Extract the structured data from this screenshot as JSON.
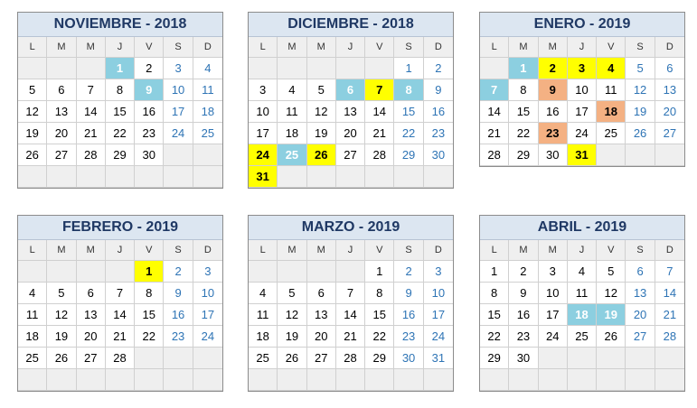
{
  "weekday_labels": [
    "L",
    "M",
    "M",
    "J",
    "V",
    "S",
    "D"
  ],
  "months": [
    {
      "title": "NOVIEMBRE - 2018",
      "offset": 3,
      "days": 30,
      "rows": 6,
      "marks": {
        "1": "festivo",
        "9": "festivo"
      }
    },
    {
      "title": "DICIEMBRE - 2018",
      "offset": 5,
      "days": 31,
      "rows": 6,
      "marks": {
        "6": "festivo",
        "7": "amarillo",
        "8": "festivo",
        "24": "amarillo",
        "25": "festivo",
        "26": "amarillo",
        "31": "amarillo"
      }
    },
    {
      "title": "ENERO - 2019",
      "offset": 1,
      "days": 31,
      "rows": 5,
      "marks": {
        "1": "festivo",
        "2": "amarillo",
        "3": "amarillo",
        "4": "amarillo",
        "7": "festivo",
        "9": "naranja",
        "18": "naranja",
        "23": "naranja",
        "31": "amarillo"
      }
    },
    {
      "title": "FEBRERO - 2019",
      "offset": 4,
      "days": 28,
      "rows": 6,
      "marks": {
        "1": "amarillo"
      }
    },
    {
      "title": "MARZO - 2019",
      "offset": 4,
      "days": 31,
      "rows": 6,
      "marks": {}
    },
    {
      "title": "ABRIL - 2019",
      "offset": 0,
      "days": 30,
      "rows": 6,
      "marks": {
        "18": "festivo",
        "19": "festivo"
      }
    }
  ]
}
